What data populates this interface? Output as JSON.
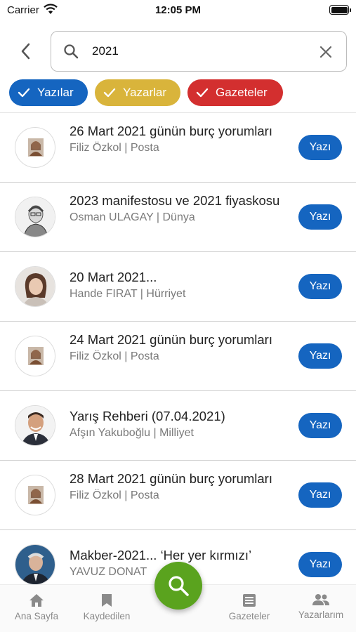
{
  "status_bar": {
    "carrier": "Carrier",
    "time": "12:05 PM"
  },
  "search": {
    "value": "2021"
  },
  "filters": [
    {
      "label": "Yazılar",
      "color": "#1565c0"
    },
    {
      "label": "Yazarlar",
      "color": "#d9b43b"
    },
    {
      "label": "Gazeteler",
      "color": "#d32f2f"
    }
  ],
  "results": [
    {
      "title": "26 Mart 2021 günün burç yorumları",
      "meta": "Filiz Özkol | Posta",
      "button": "Yazı"
    },
    {
      "title": "2023 manifestosu ve 2021 fiyaskosu",
      "meta": "Osman ULAGAY | Dünya",
      "button": "Yazı"
    },
    {
      "title": "20 Mart 2021...",
      "meta": "Hande FIRAT | Hürriyet",
      "button": "Yazı"
    },
    {
      "title": "24 Mart 2021 günün burç yorumları",
      "meta": "Filiz Özkol | Posta",
      "button": "Yazı"
    },
    {
      "title": "Yarış Rehberi (07.04.2021)",
      "meta": "Afşın Yakuboğlu | Milliyet",
      "button": "Yazı"
    },
    {
      "title": "28 Mart 2021 günün burç yorumları",
      "meta": "Filiz Özkol | Posta",
      "button": "Yazı"
    },
    {
      "title": "Makber-2021... ‘Her yer kırmızı’",
      "meta": "YAVUZ DONAT",
      "button": "Yazı"
    }
  ],
  "tabs": [
    {
      "label": "Ana Sayfa",
      "icon": "home-icon"
    },
    {
      "label": "Kaydedilen",
      "icon": "bookmark-icon"
    },
    {
      "label": "Gazeteler",
      "icon": "newspaper-icon"
    },
    {
      "label": "Yazarlarım",
      "icon": "people-icon"
    }
  ],
  "colors": {
    "accent": "#1565c0",
    "fab": "#5aa31e"
  }
}
